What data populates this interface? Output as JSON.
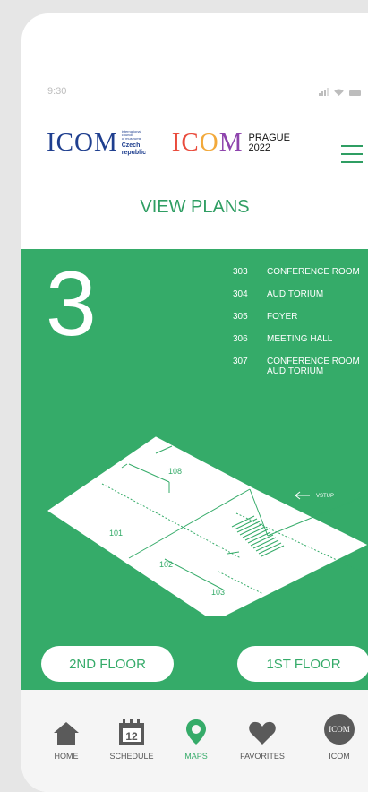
{
  "status_bar": {
    "time": "9:30"
  },
  "logos": {
    "icom_czech": {
      "text": "ICOM",
      "sub_lines": [
        "international",
        "council",
        "of museums"
      ],
      "country": "Czech republic"
    },
    "icom_prague": {
      "text_i": "IC",
      "text_o": "O",
      "text_m": "M",
      "city": "PRAGUE",
      "year": "2022"
    }
  },
  "header": {
    "title": "VIEW PLANS"
  },
  "floor": {
    "number": "3"
  },
  "rooms": [
    {
      "number": "303",
      "name": "CONFERENCE ROOM"
    },
    {
      "number": "304",
      "name": "AUDITORIUM"
    },
    {
      "number": "305",
      "name": "FOYER"
    },
    {
      "number": "306",
      "name": "MEETING HALL"
    },
    {
      "number": "307",
      "name": "CONFERENCE ROOM AUDITORIUM"
    }
  ],
  "plan": {
    "entrance_label": "VSTUP",
    "room_labels": [
      "108",
      "101",
      "102",
      "103"
    ]
  },
  "buttons": {
    "second_floor": "2ND FLOOR",
    "first_floor": "1ST FLOOR"
  },
  "nav": {
    "items": [
      {
        "label": "HOME",
        "icon": "home-icon"
      },
      {
        "label": "SCHEDULE",
        "icon": "calendar-icon",
        "badge": "12"
      },
      {
        "label": "MAPS",
        "icon": "map-pin-icon"
      },
      {
        "label": "FAVORITES",
        "icon": "heart-icon"
      },
      {
        "label": "ICOM",
        "icon": "icom-icon",
        "badge": "ICOM"
      }
    ],
    "active": "MAPS"
  },
  "colors": {
    "accent": "#35ab69",
    "text_accent": "#2f9e63",
    "nav_icon": "#5a5a5a"
  }
}
